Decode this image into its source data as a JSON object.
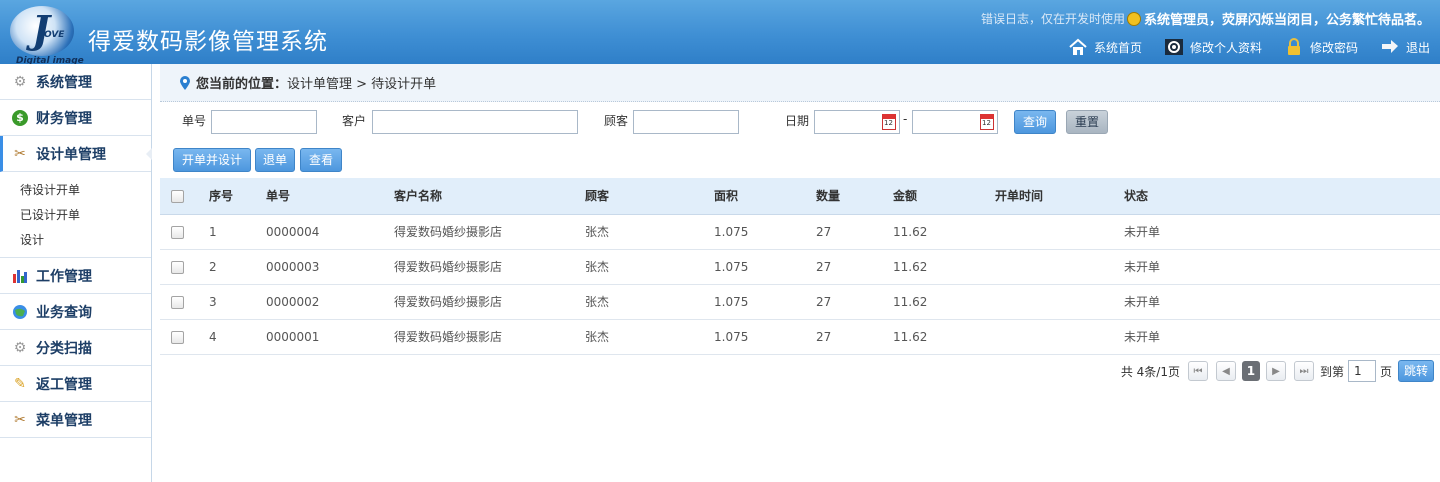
{
  "app": {
    "logo_letter": "J",
    "logo_small": "OVE",
    "logo_sub": "Digital image",
    "title": "得爱数码影像管理系统"
  },
  "header": {
    "note": "错误日志，仅在开发时使用",
    "user": "系统管理员，荧屏闪烁当闭目，公务繁忙待品茗。",
    "links": [
      "系统首页",
      "修改个人资料",
      "修改密码",
      "退出"
    ]
  },
  "sidebar": {
    "items": [
      "系统管理",
      "财务管理",
      "设计单管理",
      "工作管理",
      "业务查询",
      "分类扫描",
      "返工管理",
      "菜单管理"
    ],
    "sub_items": [
      "待设计开单",
      "已设计开单",
      "设计"
    ]
  },
  "breadcrumb": {
    "label": "您当前的位置：",
    "path": "设计单管理 > 待设计开单"
  },
  "filter": {
    "order_no_label": "单号",
    "customer_label": "客户",
    "client_label": "顾客",
    "date_label": "日期",
    "date_sep": "-",
    "query": "查询",
    "reset": "重置"
  },
  "actions": [
    "开单并设计",
    "退单",
    "查看"
  ],
  "table": {
    "headers": [
      "序号",
      "单号",
      "客户名称",
      "顾客",
      "面积",
      "数量",
      "金额",
      "开单时间",
      "状态"
    ],
    "rows": [
      [
        "1",
        "0000004",
        "得爱数码婚纱摄影店",
        "张杰",
        "1.075",
        "27",
        "11.62",
        "",
        "未开单"
      ],
      [
        "2",
        "0000003",
        "得爱数码婚纱摄影店",
        "张杰",
        "1.075",
        "27",
        "11.62",
        "",
        "未开单"
      ],
      [
        "3",
        "0000002",
        "得爱数码婚纱摄影店",
        "张杰",
        "1.075",
        "27",
        "11.62",
        "",
        "未开单"
      ],
      [
        "4",
        "0000001",
        "得爱数码婚纱摄影店",
        "张杰",
        "1.075",
        "27",
        "11.62",
        "",
        "未开单"
      ]
    ]
  },
  "pager": {
    "summary": "共 4条/1页",
    "current": "1",
    "goto_label": "到第",
    "page_value": "1",
    "page_unit": "页",
    "go": "跳转"
  }
}
